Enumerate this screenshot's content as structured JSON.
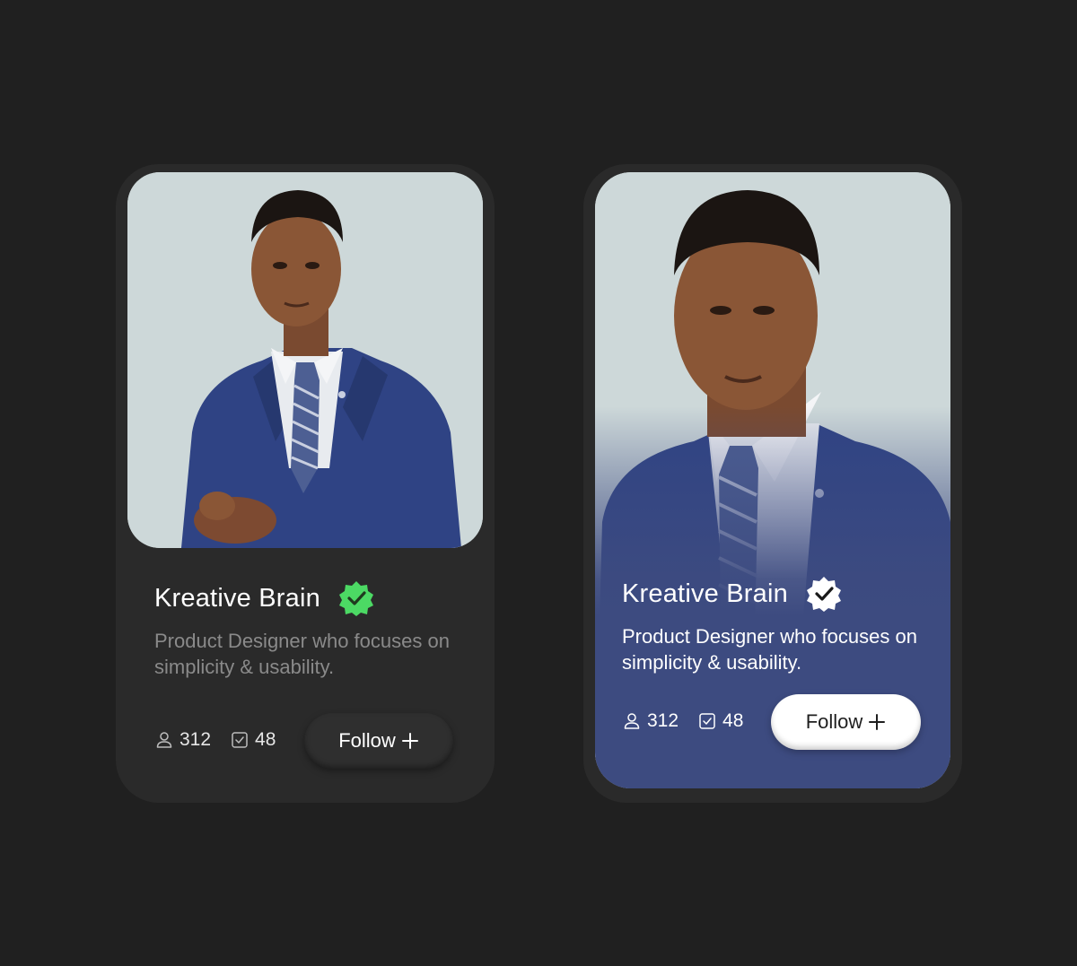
{
  "cards": [
    {
      "variant": "dark",
      "name": "Kreative Brain",
      "bio": "Product Designer who focuses on simplicity & usability.",
      "followers": "312",
      "projects": "48",
      "follow_label": "Follow",
      "verified_color": "#4cd964",
      "background_color": "#2a2a2a"
    },
    {
      "variant": "blue",
      "name": "Kreative Brain",
      "bio": "Product Designer who focuses on simplicity & usability.",
      "followers": "312",
      "projects": "48",
      "follow_label": "Follow",
      "verified_color": "#ffffff",
      "background_color": "#3d4b80"
    }
  ],
  "icons": {
    "verified": "verified-badge-icon",
    "followers": "user-icon",
    "projects": "checkbox-icon",
    "follow": "plus-icon"
  },
  "colors": {
    "page_background": "#202020",
    "photo_background": "#cdd8d9",
    "suit_blue": "#2f4384"
  }
}
